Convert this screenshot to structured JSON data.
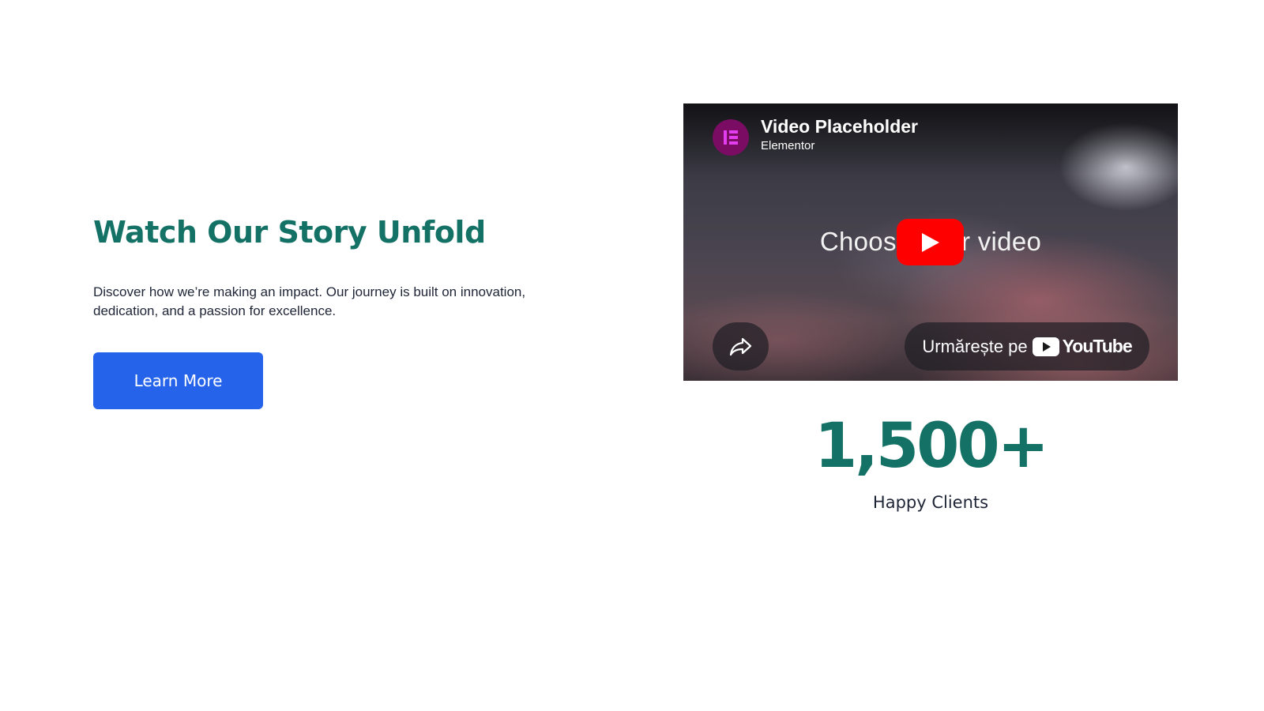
{
  "section": {
    "title": "Watch Our Story Unfold",
    "description": "Discover how we’re making an impact. Our journey is built on innovation, dedication, and a passion for excellence.",
    "cta_label": "Learn More"
  },
  "video": {
    "title": "Video Placeholder",
    "channel": "Elementor",
    "center_text": "Choose your video",
    "watch_on_label": "Urmărește pe",
    "platform_name": "YouTube",
    "icons": {
      "avatar": "elementor-logo-icon",
      "play": "play-icon",
      "share": "share-icon",
      "platform": "youtube-logo-icon"
    }
  },
  "stat": {
    "value": "1,500+",
    "label": "Happy Clients"
  },
  "colors": {
    "accent_green": "#147165",
    "button_blue": "#2563eb",
    "text_dark": "#1e2536",
    "youtube_red": "#ff0000",
    "elementor_purple": "#7a0d63"
  }
}
